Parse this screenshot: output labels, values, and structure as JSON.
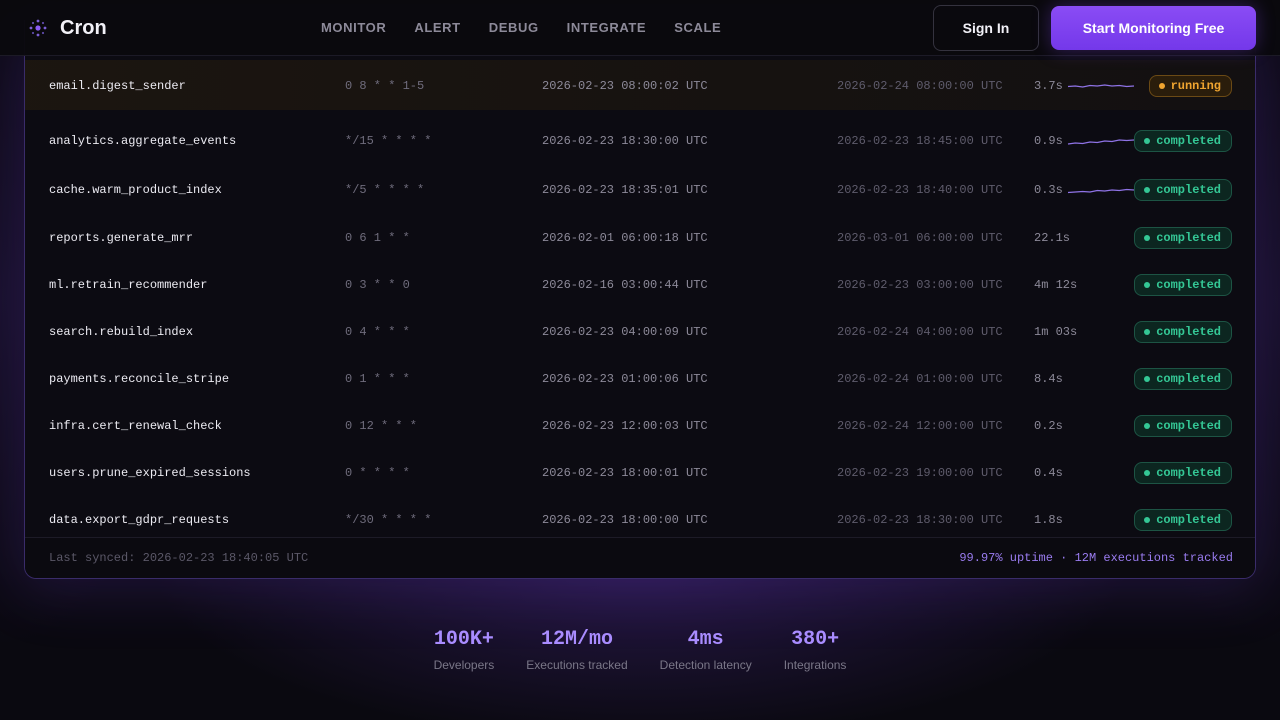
{
  "nav": {
    "brand": "Cron",
    "links": [
      "MONITOR",
      "ALERT",
      "DEBUG",
      "INTEGRATE",
      "SCALE"
    ],
    "sign_in": "Sign In",
    "cta": "Start Monitoring Free"
  },
  "jobs": [
    {
      "name": "email.digest_sender",
      "schedule": "0 8 * * 1-5",
      "last_run": "2026-02-23 08:00:02 UTC",
      "next_run": "2026-02-24 08:00:00 UTC",
      "duration": "3.7s",
      "status": "running",
      "trend": [
        0.45,
        0.5,
        0.4,
        0.55,
        0.5,
        0.6,
        0.5,
        0.55,
        0.45,
        0.5
      ]
    },
    {
      "name": "analytics.aggregate_events",
      "schedule": "*/15 * * * *",
      "last_run": "2026-02-23 18:30:00 UTC",
      "next_run": "2026-02-23 18:45:00 UTC",
      "duration": "0.9s",
      "status": "completed",
      "trend": [
        0.2,
        0.3,
        0.25,
        0.4,
        0.35,
        0.5,
        0.45,
        0.6,
        0.55,
        0.6
      ]
    },
    {
      "name": "cache.warm_product_index",
      "schedule": "*/5 * * * *",
      "last_run": "2026-02-23 18:35:01 UTC",
      "next_run": "2026-02-23 18:40:00 UTC",
      "duration": "0.3s",
      "status": "completed",
      "trend": [
        0.25,
        0.3,
        0.35,
        0.3,
        0.45,
        0.4,
        0.5,
        0.45,
        0.55,
        0.5
      ]
    },
    {
      "name": "reports.generate_mrr",
      "schedule": "0 6 1 * *",
      "last_run": "2026-02-01 06:00:18 UTC",
      "next_run": "2026-03-01 06:00:00 UTC",
      "duration": "22.1s",
      "status": "completed"
    },
    {
      "name": "ml.retrain_recommender",
      "schedule": "0 3 * * 0",
      "last_run": "2026-02-16 03:00:44 UTC",
      "next_run": "2026-02-23 03:00:00 UTC",
      "duration": "4m 12s",
      "status": "completed"
    },
    {
      "name": "search.rebuild_index",
      "schedule": "0 4 * * *",
      "last_run": "2026-02-23 04:00:09 UTC",
      "next_run": "2026-02-24 04:00:00 UTC",
      "duration": "1m 03s",
      "status": "completed"
    },
    {
      "name": "payments.reconcile_stripe",
      "schedule": "0 1 * * *",
      "last_run": "2026-02-23 01:00:06 UTC",
      "next_run": "2026-02-24 01:00:00 UTC",
      "duration": "8.4s",
      "status": "completed"
    },
    {
      "name": "infra.cert_renewal_check",
      "schedule": "0 12 * * *",
      "last_run": "2026-02-23 12:00:03 UTC",
      "next_run": "2026-02-24 12:00:00 UTC",
      "duration": "0.2s",
      "status": "completed"
    },
    {
      "name": "users.prune_expired_sessions",
      "schedule": "0 * * * *",
      "last_run": "2026-02-23 18:00:01 UTC",
      "next_run": "2026-02-23 19:00:00 UTC",
      "duration": "0.4s",
      "status": "completed"
    },
    {
      "name": "data.export_gdpr_requests",
      "schedule": "*/30 * * * *",
      "last_run": "2026-02-23 18:00:00 UTC",
      "next_run": "2026-02-23 18:30:00 UTC",
      "duration": "1.8s",
      "status": "completed"
    }
  ],
  "footer": {
    "last_synced": "Last synced: 2026-02-23 18:40:05 UTC",
    "uptime": "99.97% uptime · 12M executions tracked"
  },
  "stats": [
    {
      "value": "100K+",
      "label": "Developers"
    },
    {
      "value": "12M/mo",
      "label": "Executions tracked"
    },
    {
      "value": "4ms",
      "label": "Detection latency"
    },
    {
      "value": "380+",
      "label": "Integrations"
    }
  ],
  "colors": {
    "accent": "#7c3aed",
    "stat_value": "#a98cff",
    "running": "#f0a530",
    "completed": "#34c795",
    "sparkline": "#8f73e6"
  },
  "icons": {
    "brand": "dotted-cron-logo-icon"
  }
}
